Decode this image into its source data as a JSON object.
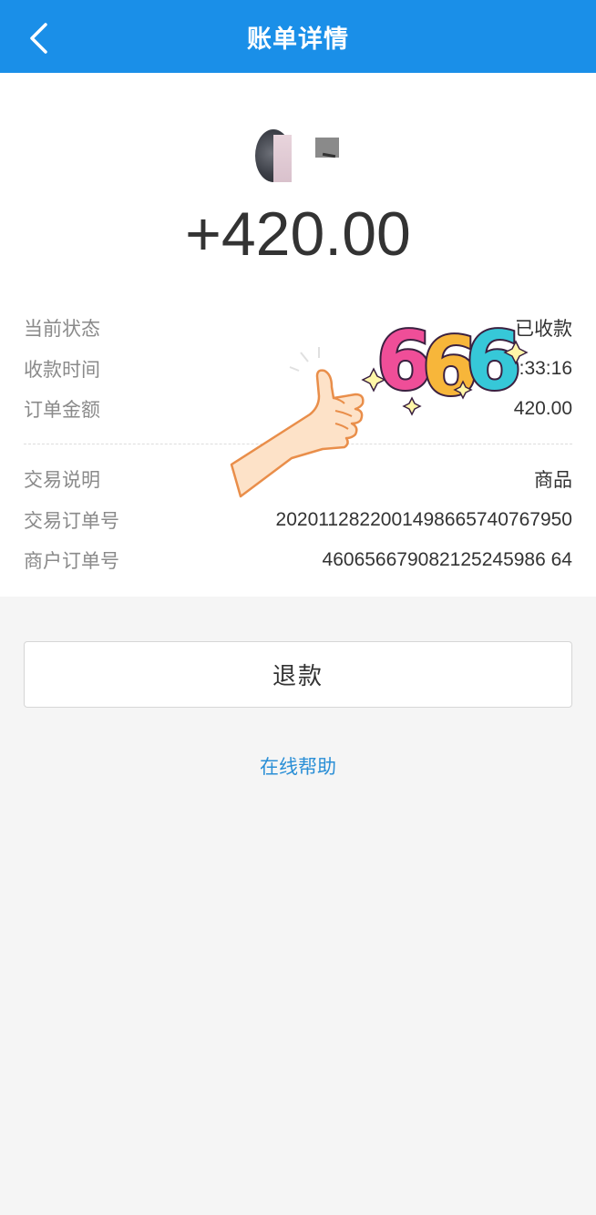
{
  "header": {
    "title": "账单详情",
    "back_icon": "chevron-left-icon"
  },
  "payer": {
    "avatar": "user-avatar",
    "name_redacted": "mosaic"
  },
  "amount": "+420.00",
  "details": [
    {
      "label": "当前状态",
      "value": "已收款"
    },
    {
      "label": "收款时间",
      "value": ":33:16"
    },
    {
      "label": "订单金额",
      "value": "420.00"
    },
    {
      "label": "交易说明",
      "value": "商品"
    },
    {
      "label": "交易订单号",
      "value": "2020112822001498665740767950"
    },
    {
      "label": "商户订单号",
      "value": "460656679082125245986 64"
    }
  ],
  "actions": {
    "refund_label": "退款",
    "help_label": "在线帮助"
  },
  "sticker": {
    "text": "666",
    "icon": "thumbs-up-icon"
  },
  "colors": {
    "nav_bg": "#1a8fe8",
    "link": "#2b8fd6",
    "page_bg": "#f5f5f5"
  }
}
